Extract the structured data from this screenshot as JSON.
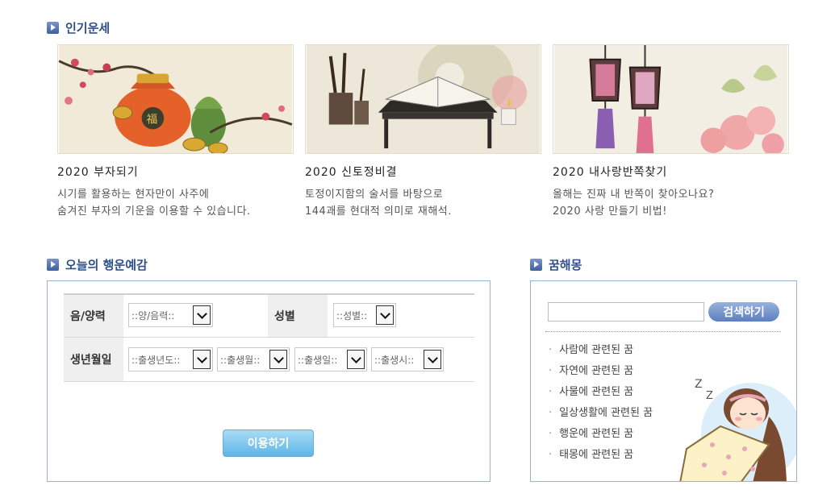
{
  "popular": {
    "title": "인기운세",
    "cards": [
      {
        "title": "2020 부자되기",
        "desc1": "시기를 활용하는 현자만이 사주에",
        "desc2": "숨겨진 부자의 기운을 이용할 수 있습니다."
      },
      {
        "title": "2020 신토정비결",
        "desc1": "토정이지함의 술서를 바탕으로",
        "desc2": "144괘를 현대적 의미로 재해석."
      },
      {
        "title": "2020 내사랑반쪽찾기",
        "desc1": "올해는 진짜 내 반쪽이 찾아오나요?",
        "desc2": "2020 사랑 만들기 비법!"
      }
    ]
  },
  "fortune": {
    "title": "오늘의 행운예감",
    "lunar_label": "음/양력",
    "lunar_select": "::양/음력::",
    "gender_label": "성별",
    "gender_select": "::성별::",
    "birth_label": "생년월일",
    "year_select": "::출생년도::",
    "month_select": "::출생월::",
    "day_select": "::출생일::",
    "hour_select": "::출생시::",
    "submit": "이용하기"
  },
  "dream": {
    "title": "꿈해몽",
    "search_button": "검색하기",
    "search_value": "",
    "items": [
      "사람에 관련된 꿈",
      "자연에 관련된 꿈",
      "사물에 관련된 꿈",
      "일상생활에 관련된 꿈",
      "행운에 관련된 꿈",
      "태몽에 관련된 꿈"
    ]
  }
}
